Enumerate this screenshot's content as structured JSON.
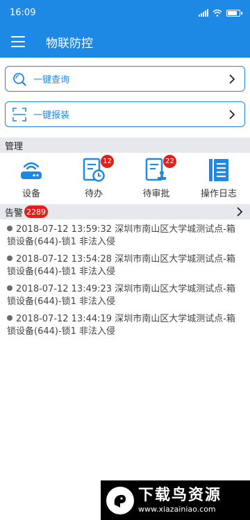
{
  "status_bar": {
    "time": "16:09"
  },
  "app_bar": {
    "title": "物联防控"
  },
  "actions": [
    {
      "label": "一键查询",
      "icon": "search-icon"
    },
    {
      "label": "一键报装",
      "icon": "scan-icon"
    }
  ],
  "management": {
    "header": "管理",
    "items": [
      {
        "label": "设备",
        "icon": "router-icon",
        "badge": ""
      },
      {
        "label": "待办",
        "icon": "todo-icon",
        "badge": "12"
      },
      {
        "label": "待审批",
        "icon": "approval-icon",
        "badge": "22"
      },
      {
        "label": "操作日志",
        "icon": "log-icon",
        "badge": ""
      }
    ]
  },
  "alarms": {
    "header": "告警",
    "count": "2289",
    "items": [
      {
        "text": "2018-07-12 13:59:32 深圳市南山区大学城测试点-箱锁设备(644)-锁1 非法入侵"
      },
      {
        "text": "2018-07-12 13:54:28 深圳市南山区大学城测试点-箱锁设备(644)-锁1 非法入侵"
      },
      {
        "text": "2018-07-12 13:49:23 深圳市南山区大学城测试点-箱锁设备(644)-锁1 非法入侵"
      },
      {
        "text": "2018-07-12 13:44:19 深圳市南山区大学城测试点-箱锁设备(644)-锁1 非法入侵"
      }
    ]
  },
  "watermark": {
    "title": "下载鸟资源",
    "url": "www.xiazainiao.com"
  },
  "colors": {
    "primary": "#1e88e5",
    "badge": "#e0201b",
    "section_bg": "#e6e8ec"
  }
}
